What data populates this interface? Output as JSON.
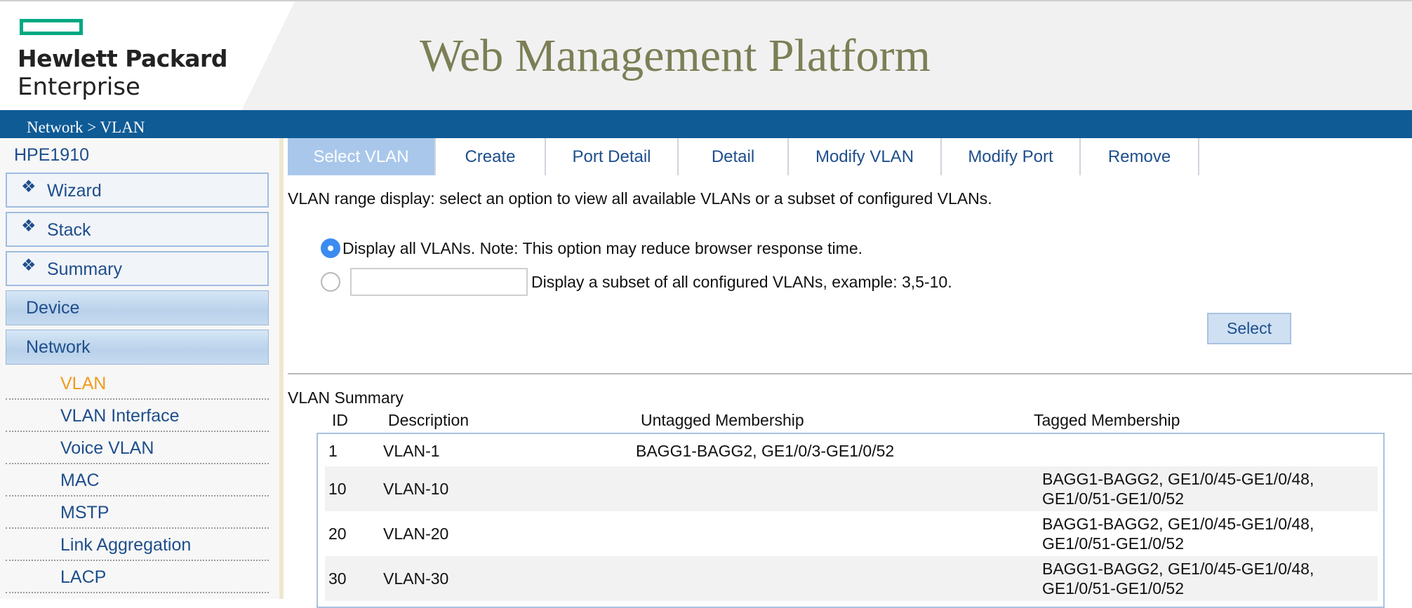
{
  "header": {
    "logo_line1": "Hewlett Packard",
    "logo_line2": "Enterprise",
    "title": "Web Management Platform",
    "brand_color": "#01a982"
  },
  "breadcrumb": "Network > VLAN",
  "sidebar": {
    "device_name": "HPE1910",
    "boxes": [
      {
        "label": "Wizard",
        "icon": "diamond-bullet-icon"
      },
      {
        "label": "Stack",
        "icon": "diamond-bullet-icon"
      },
      {
        "label": "Summary",
        "icon": "diamond-bullet-icon"
      }
    ],
    "bullet_glyph": "❖",
    "sections": [
      "Device",
      "Network"
    ],
    "network_items": [
      "VLAN",
      "VLAN Interface",
      "Voice VLAN",
      "MAC",
      "MSTP",
      "Link Aggregation",
      "LACP"
    ],
    "active_item": "VLAN"
  },
  "tabs": [
    "Select VLAN",
    "Create",
    "Port Detail",
    "Detail",
    "Modify VLAN",
    "Modify Port",
    "Remove"
  ],
  "active_tab": "Select VLAN",
  "select_vlan": {
    "range_description": "VLAN range display: select an option to view all available VLANs or a subset of configured VLANs.",
    "option_all": "Display all VLANs. Note: This option may reduce browser response time.",
    "option_subset": "Display a subset of all configured VLANs, example: 3,5-10.",
    "subset_value": "",
    "selected_option": "all",
    "select_button": "Select"
  },
  "summary": {
    "title": "VLAN Summary",
    "columns": [
      "ID",
      "Description",
      "Untagged Membership",
      "Tagged Membership"
    ],
    "rows": [
      {
        "id": "1",
        "description": "VLAN-1",
        "untagged": "BAGG1-BAGG2, GE1/0/3-GE1/0/52",
        "tagged": ""
      },
      {
        "id": "10",
        "description": "VLAN-10",
        "untagged": "",
        "tagged": "BAGG1-BAGG2, GE1/0/45-GE1/0/48, GE1/0/51-GE1/0/52"
      },
      {
        "id": "20",
        "description": "VLAN-20",
        "untagged": "",
        "tagged": "BAGG1-BAGG2, GE1/0/45-GE1/0/48, GE1/0/51-GE1/0/52"
      },
      {
        "id": "30",
        "description": "VLAN-30",
        "untagged": "",
        "tagged": "BAGG1-BAGG2, GE1/0/45-GE1/0/48, GE1/0/51-GE1/0/52"
      }
    ]
  }
}
